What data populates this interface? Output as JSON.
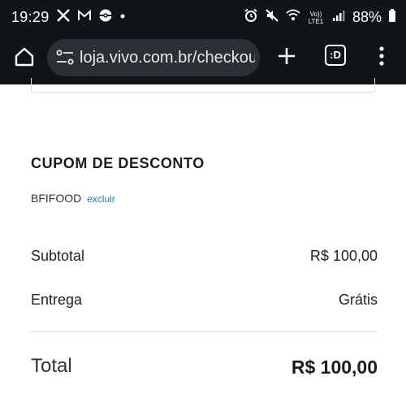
{
  "status_bar": {
    "time": "19:29",
    "battery_percent": "88%",
    "network_label": "Vo)) LTE1"
  },
  "browser": {
    "url": "loja.vivo.com.br/checkout",
    "tabs_label": ":D"
  },
  "coupon": {
    "title": "CUPOM DE DESCONTO",
    "code": "BFIFOOD",
    "remove_label": "excluir"
  },
  "summary": {
    "subtotal_label": "Subtotal",
    "subtotal_value": "R$ 100,00",
    "delivery_label": "Entrega",
    "delivery_value": "Grátis",
    "total_label": "Total",
    "total_value": "R$ 100,00"
  },
  "colors": {
    "status_bg": "#111418",
    "url_pill_bg": "#2b2f36",
    "link": "#1a7fa8"
  }
}
